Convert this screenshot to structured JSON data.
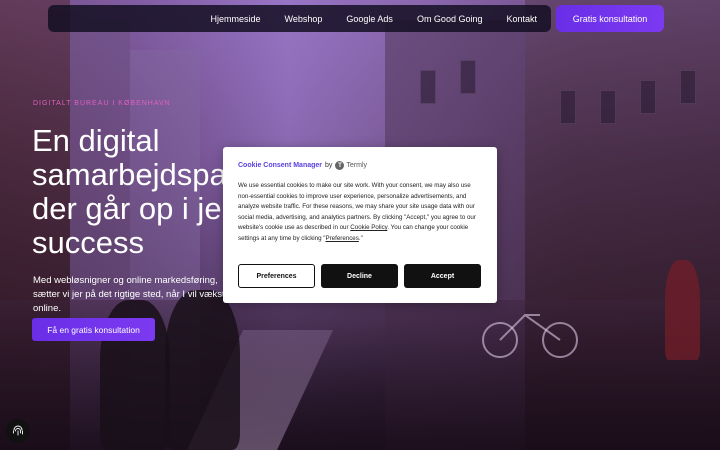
{
  "nav": {
    "items": [
      "Hjemmeside",
      "Webshop",
      "Google Ads",
      "Om Good Going",
      "Kontakt"
    ],
    "cta": "Gratis konsultation"
  },
  "hero": {
    "eyebrow": "DIGITALT BUREAU I KØBENHAVN",
    "headline": "En digital samarbejdspartner, der går op i jeres success",
    "lead": "Med webløsnigner og online markedsføring, sætter vi jer på det rigtige sted, når I vil vækste online.",
    "cta": "Få en gratis konsultation"
  },
  "cookie": {
    "title": "Cookie Consent Manager",
    "by": "by",
    "provider": "Termly",
    "body_1": "We use essential cookies to make our site work. With your consent, we may also use non-essential cookies to improve user experience, personalize advertisements, and analyze website traffic. For these reasons, we may share your site usage data with our social media, advertising, and analytics partners. By clicking \"Accept,\" you agree to our website's cookie use as described in our ",
    "policy_link": "Cookie Policy",
    "body_2": ". You can change your cookie settings at any time by clicking \"",
    "prefs_link": "Preferences",
    "body_3": ".\"",
    "buttons": {
      "preferences": "Preferences",
      "decline": "Decline",
      "accept": "Accept"
    }
  },
  "colors": {
    "accent": "#6a2ee8",
    "eyebrow": "#e05fc2",
    "brand": "#5a3ee0"
  },
  "icons": {
    "termly": "termly-logo-icon",
    "badge": "fingerprint-icon"
  }
}
